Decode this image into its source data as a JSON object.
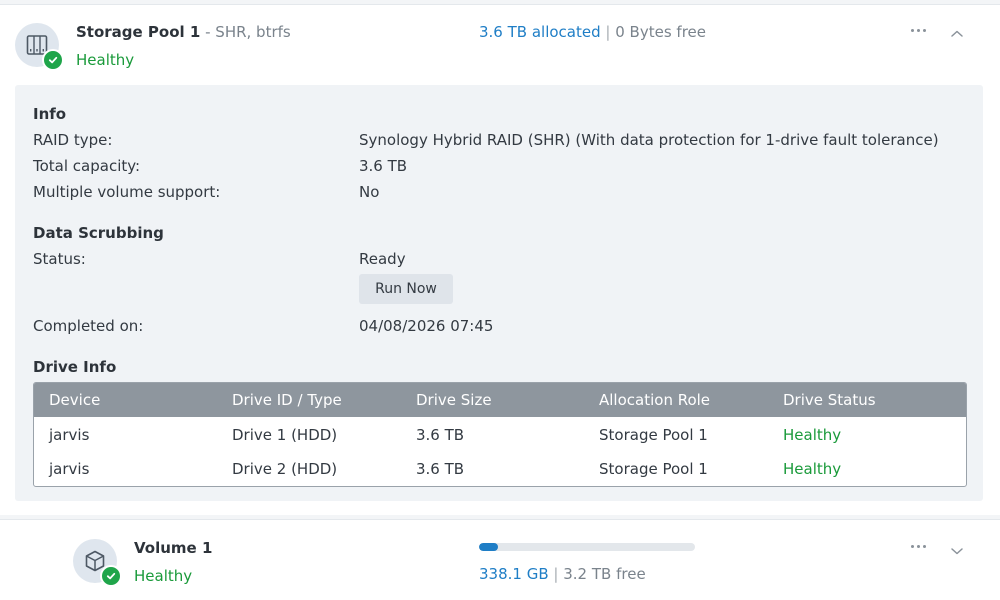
{
  "storage_pool": {
    "title": "Storage Pool 1",
    "subtitle": " - SHR, btrfs",
    "status": "Healthy",
    "allocated": "3.6 TB allocated",
    "separator": "|",
    "free": "0 Bytes free",
    "icon": "nas-drives-icon"
  },
  "info": {
    "section_title": "Info",
    "rows": [
      {
        "label": "RAID type:",
        "value": "Synology Hybrid RAID (SHR) (With data protection for 1-drive fault tolerance)"
      },
      {
        "label": "Total capacity:",
        "value": "3.6 TB"
      },
      {
        "label": "Multiple volume support:",
        "value": "No"
      }
    ]
  },
  "scrubbing": {
    "section_title": "Data Scrubbing",
    "status_label": "Status:",
    "status_value": "Ready",
    "run_button": "Run Now",
    "completed_label": "Completed on:",
    "completed_value": "04/08/2026 07:45"
  },
  "drive_info": {
    "section_title": "Drive Info",
    "columns": [
      "Device",
      "Drive ID / Type",
      "Drive Size",
      "Allocation Role",
      "Drive Status"
    ],
    "rows": [
      [
        "jarvis",
        "Drive 1 (HDD)",
        "3.6 TB",
        "Storage Pool 1",
        "Healthy"
      ],
      [
        "jarvis",
        "Drive 2 (HDD)",
        "3.6 TB",
        "Storage Pool 1",
        "Healthy"
      ]
    ]
  },
  "volume": {
    "title": "Volume 1",
    "status": "Healthy",
    "used": "338.1 GB",
    "separator": "|",
    "free": "3.2 TB free",
    "usage_fraction": 0.09,
    "icon": "cube-icon"
  },
  "colors": {
    "healthy": "#1a9a3a",
    "accent": "#1f7ec6",
    "header_gray": "#8e969e"
  }
}
